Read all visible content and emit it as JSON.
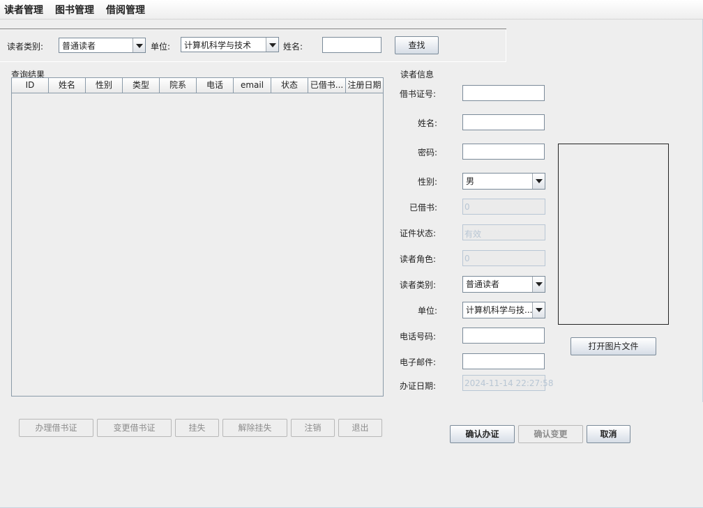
{
  "menubar": [
    "读者管理",
    "图书管理",
    "借阅管理"
  ],
  "search": {
    "category_label": "读者类别:",
    "category_value": "普通读者",
    "unit_label": "单位:",
    "unit_value": "计算机科学与技术",
    "name_label": "姓名:",
    "name_value": "",
    "search_button": "查找"
  },
  "results": {
    "title": "查询结果",
    "columns": [
      "ID",
      "姓名",
      "性别",
      "类型",
      "院系",
      "电话",
      "email",
      "状态",
      "已借书...",
      "注册日期"
    ],
    "rows": []
  },
  "actions": [
    "办理借书证",
    "变更借书证",
    "挂失",
    "解除挂失",
    "注销",
    "退出"
  ],
  "reader": {
    "title": "读者信息",
    "card_no_label": "借书证号:",
    "card_no": "",
    "name_label": "姓名:",
    "name": "",
    "password_label": "密码:",
    "password": "",
    "gender_label": "性别:",
    "gender": "男",
    "borrowed_label": "已借书:",
    "borrowed": "0",
    "status_label": "证件状态:",
    "status": "有效",
    "role_label": "读者角色:",
    "role": "0",
    "category_label": "读者类别:",
    "category": "普通读者",
    "unit_label": "单位:",
    "unit": "计算机科学与技...",
    "phone_label": "电话号码:",
    "phone": "",
    "email_label": "电子邮件:",
    "email": "",
    "date_label": "办证日期:",
    "date": "2024-11-14 22:27:58"
  },
  "open_image_button": "打开图片文件",
  "confirm_buttons": [
    "确认办证",
    "确认变更",
    "取消"
  ]
}
